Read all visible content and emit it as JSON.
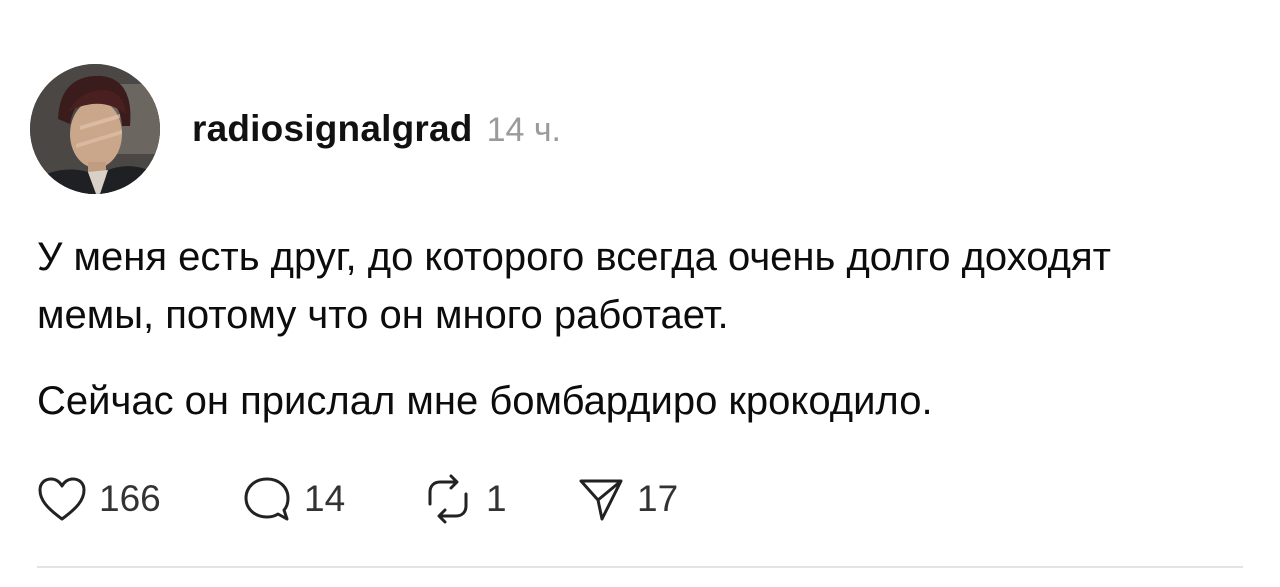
{
  "post": {
    "author": {
      "username": "radiosignalgrad",
      "time": "14 ч.",
      "avatar_icon": "user-avatar-photo"
    },
    "paragraphs": [
      "У меня есть друг, до которого всегда очень долго доходят мемы, потому что он много работает.",
      "Сейчас он прислал мне бомбардиро крокодило."
    ],
    "actions": {
      "likes": "166",
      "replies": "14",
      "reposts": "1",
      "shares": "17"
    },
    "icons": {
      "like": "heart-icon",
      "reply": "comment-bubble-icon",
      "repost": "repost-icon",
      "share": "send-icon"
    },
    "colors": {
      "text": "#0c0c0c",
      "muted": "#9a9a9a",
      "divider": "#e3e3e3"
    }
  }
}
